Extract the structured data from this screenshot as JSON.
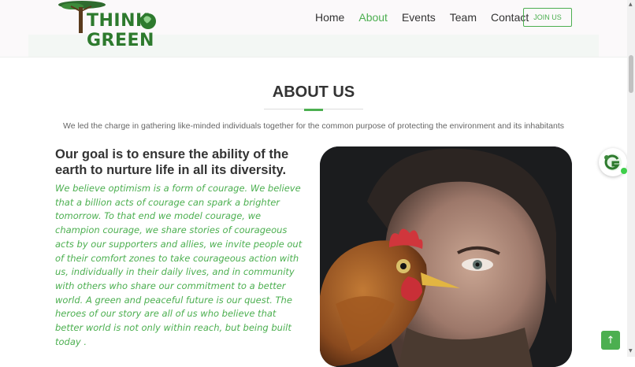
{
  "brand": {
    "logo_text": "THINK GREEN"
  },
  "nav": {
    "items": [
      {
        "label": "Home",
        "active": false
      },
      {
        "label": "About",
        "active": true
      },
      {
        "label": "Events",
        "active": false
      },
      {
        "label": "Team",
        "active": false
      },
      {
        "label": "Contact",
        "active": false
      }
    ],
    "cta": "JOIN US"
  },
  "about": {
    "title": "ABOUT US",
    "subtitle": "We led the charge in gathering like-minded individuals together for the common purpose of protecting the environment and its inhabitants",
    "goal_heading": "Our goal is to ensure the ability of the earth to nurture life in all its diversity.",
    "body": "We believe optimism is a form of courage. We believe that a billion acts of courage can spark a brighter tomorrow. To that end we model courage, we champion courage, we share stories of courageous acts by our supporters and allies, we invite people out of their comfort zones to take courageous action with us, individually in their daily lives, and in community with others who share our commitment to a better world. A green and peaceful future is our quest. The heroes of our story are all of us who believe that better world is not only within reach, but being built today ."
  },
  "icons": {
    "chat": "chat-avatar-icon",
    "back_to_top": "arrow-up-icon"
  },
  "colors": {
    "accent": "#4caf50",
    "text": "#333333"
  }
}
